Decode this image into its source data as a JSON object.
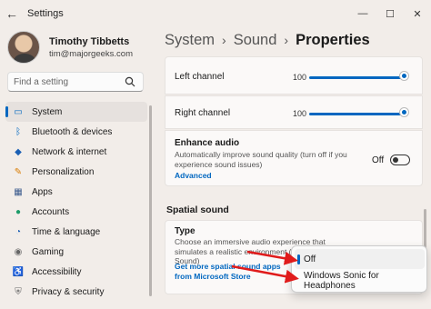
{
  "window": {
    "title": "Settings",
    "back_glyph": "←",
    "min_glyph": "—",
    "max_glyph": "☐",
    "close_glyph": "✕"
  },
  "profile": {
    "name": "Timothy Tibbetts",
    "email": "tim@majorgeeks.com"
  },
  "search": {
    "placeholder": "Find a setting"
  },
  "sidebar": {
    "items": [
      {
        "label": "System",
        "icon": "monitor-icon",
        "glyph": "▭",
        "color": "#0067c0",
        "active": true
      },
      {
        "label": "Bluetooth & devices",
        "icon": "bluetooth-icon",
        "glyph": "ᛒ",
        "color": "#0067c0",
        "active": false
      },
      {
        "label": "Network & internet",
        "icon": "wifi-icon",
        "glyph": "◆",
        "color": "#1a5fb4",
        "active": false
      },
      {
        "label": "Personalization",
        "icon": "brush-icon",
        "glyph": "✎",
        "color": "#d97b00",
        "active": false
      },
      {
        "label": "Apps",
        "icon": "apps-icon",
        "glyph": "▦",
        "color": "#3a5a8c",
        "active": false
      },
      {
        "label": "Accounts",
        "icon": "person-icon",
        "glyph": "●",
        "color": "#1e9c6a",
        "active": false
      },
      {
        "label": "Time & language",
        "icon": "globe-clock-icon",
        "glyph": "◔",
        "color": "#1a5fb4",
        "active": false
      },
      {
        "label": "Gaming",
        "icon": "controller-icon",
        "glyph": "◉",
        "color": "#666666",
        "active": false
      },
      {
        "label": "Accessibility",
        "icon": "accessibility-icon",
        "glyph": "♿",
        "color": "#1a5fb4",
        "active": false
      },
      {
        "label": "Privacy & security",
        "icon": "shield-icon",
        "glyph": "⛨",
        "color": "#666666",
        "active": false
      }
    ]
  },
  "breadcrumb": {
    "items": [
      "System",
      "Sound"
    ],
    "current": "Properties",
    "separator": "›"
  },
  "channels": {
    "left_label": "Left channel",
    "left_value": "100",
    "right_label": "Right channel",
    "right_value": "100"
  },
  "enhance": {
    "title": "Enhance audio",
    "description": "Automatically improve sound quality (turn off if you experience sound issues)",
    "link": "Advanced",
    "toggle_label": "Off",
    "toggle_on": false
  },
  "spatial": {
    "section_title": "Spatial sound",
    "type_title": "Type",
    "type_description": "Choose an immersive audio experience that simulates a realistic environment (Spatial Sound)",
    "link": "Get more spatial sound apps from Microsoft Store",
    "options": [
      "Off",
      "Windows Sonic for Headphones"
    ],
    "selected": "Off"
  },
  "colors": {
    "accent": "#0067c0",
    "annotation_arrow": "#e01b1b"
  }
}
